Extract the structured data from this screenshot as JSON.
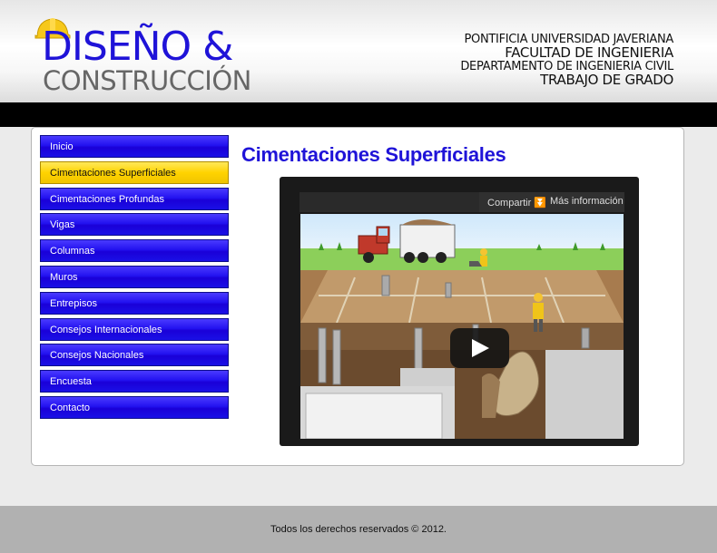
{
  "header": {
    "logo": {
      "line1": "DISEÑO &",
      "line2": "CONSTRUCCIÓN"
    },
    "institution": [
      "PONTIFICIA UNIVERSIDAD JAVERIANA",
      "FACULTAD DE INGENIERIA",
      "DEPARTAMENTO DE INGENIERIA CIVIL",
      "TRABAJO DE GRADO"
    ]
  },
  "nav": {
    "items": [
      {
        "label": "Inicio"
      },
      {
        "label": "Cimentaciones Superficiales",
        "active": true
      },
      {
        "label": "Cimentaciones Profundas"
      },
      {
        "label": "Vigas"
      },
      {
        "label": "Columnas"
      },
      {
        "label": "Muros"
      },
      {
        "label": "Entrepisos"
      },
      {
        "label": "Consejos Internacionales"
      },
      {
        "label": "Consejos Nacionales"
      },
      {
        "label": "Encuesta"
      },
      {
        "label": "Contacto"
      }
    ]
  },
  "main": {
    "title": "Cimentaciones Superficiales",
    "video": {
      "share_label": "Compartir",
      "more_info_label": "Más información",
      "icons": [
        "share-icon",
        "play-icon"
      ]
    }
  },
  "footer": {
    "text": "Todos los derechos reservados © 2012."
  },
  "colors": {
    "brand_blue": "#1f13d8",
    "active_yellow": "#ffd300",
    "header_black": "#000000",
    "footer_gray": "#b1b1b1"
  }
}
